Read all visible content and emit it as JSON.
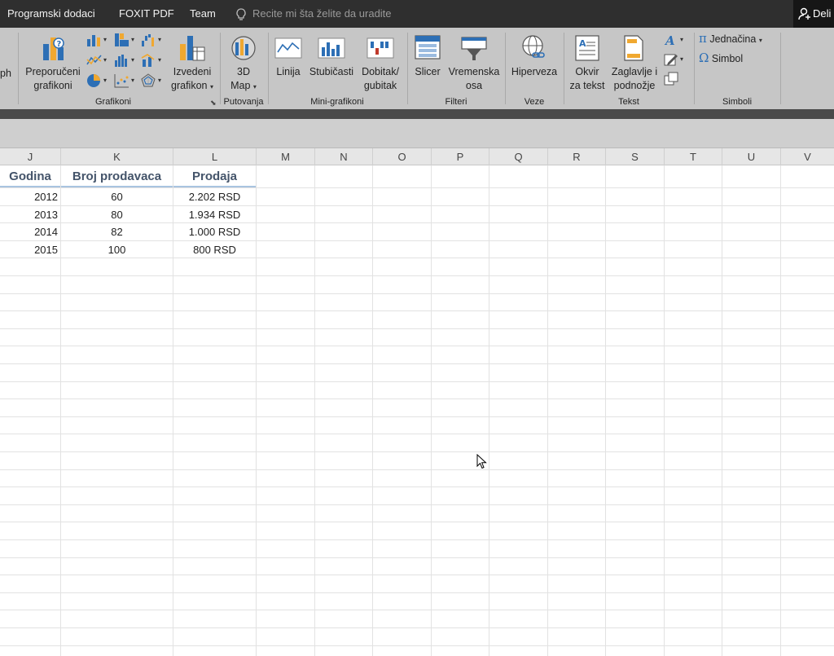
{
  "menu": {
    "items": [
      "Programski dodaci",
      "FOXIT PDF",
      "Team"
    ],
    "tell_me_placeholder": "Recite mi šta želite da uradite",
    "share_label": "Deli"
  },
  "ribbon": {
    "partial_label": "ph",
    "groups": {
      "charts": "Grafikoni",
      "tours": "Putovanja",
      "sparklines": "Mini-grafikoni",
      "filters": "Filteri",
      "links": "Veze",
      "text": "Tekst",
      "symbols": "Simboli"
    },
    "buttons": {
      "recommended_line1": "Preporučeni",
      "recommended_line2": "grafikoni",
      "pivot_line1": "Izvedeni",
      "pivot_line2": "grafikon",
      "map3d_line1": "3D",
      "map3d_line2": "Map",
      "line": "Linija",
      "column": "Stubičasti",
      "winloss_line1": "Dobitak/",
      "winloss_line2": "gubitak",
      "slicer": "Slicer",
      "timeline_line1": "Vremenska",
      "timeline_line2": "osa",
      "hyperlink": "Hiperveza",
      "textbox_line1": "Okvir",
      "textbox_line2": "za tekst",
      "headerfooter_line1": "Zaglavlje i",
      "headerfooter_line2": "podnožje",
      "equation": "Jednačina",
      "symbol": "Simbol"
    }
  },
  "columns": [
    "J",
    "K",
    "L",
    "M",
    "N",
    "O",
    "P",
    "Q",
    "R",
    "S",
    "T",
    "U",
    "V"
  ],
  "table": {
    "headers": [
      "Godina",
      "Broj prodavaca",
      "Prodaja"
    ],
    "rows": [
      [
        "2012",
        "60",
        "2.202 RSD"
      ],
      [
        "2013",
        "80",
        "1.934 RSD"
      ],
      [
        "2014",
        "82",
        "1.000 RSD"
      ],
      [
        "2015",
        "100",
        "800 RSD"
      ]
    ]
  },
  "colors": {
    "menubar": "#2f2f2f",
    "ribbon": "#c6c6c6",
    "header_text": "#44546a",
    "header_border": "#a9c4e0"
  }
}
